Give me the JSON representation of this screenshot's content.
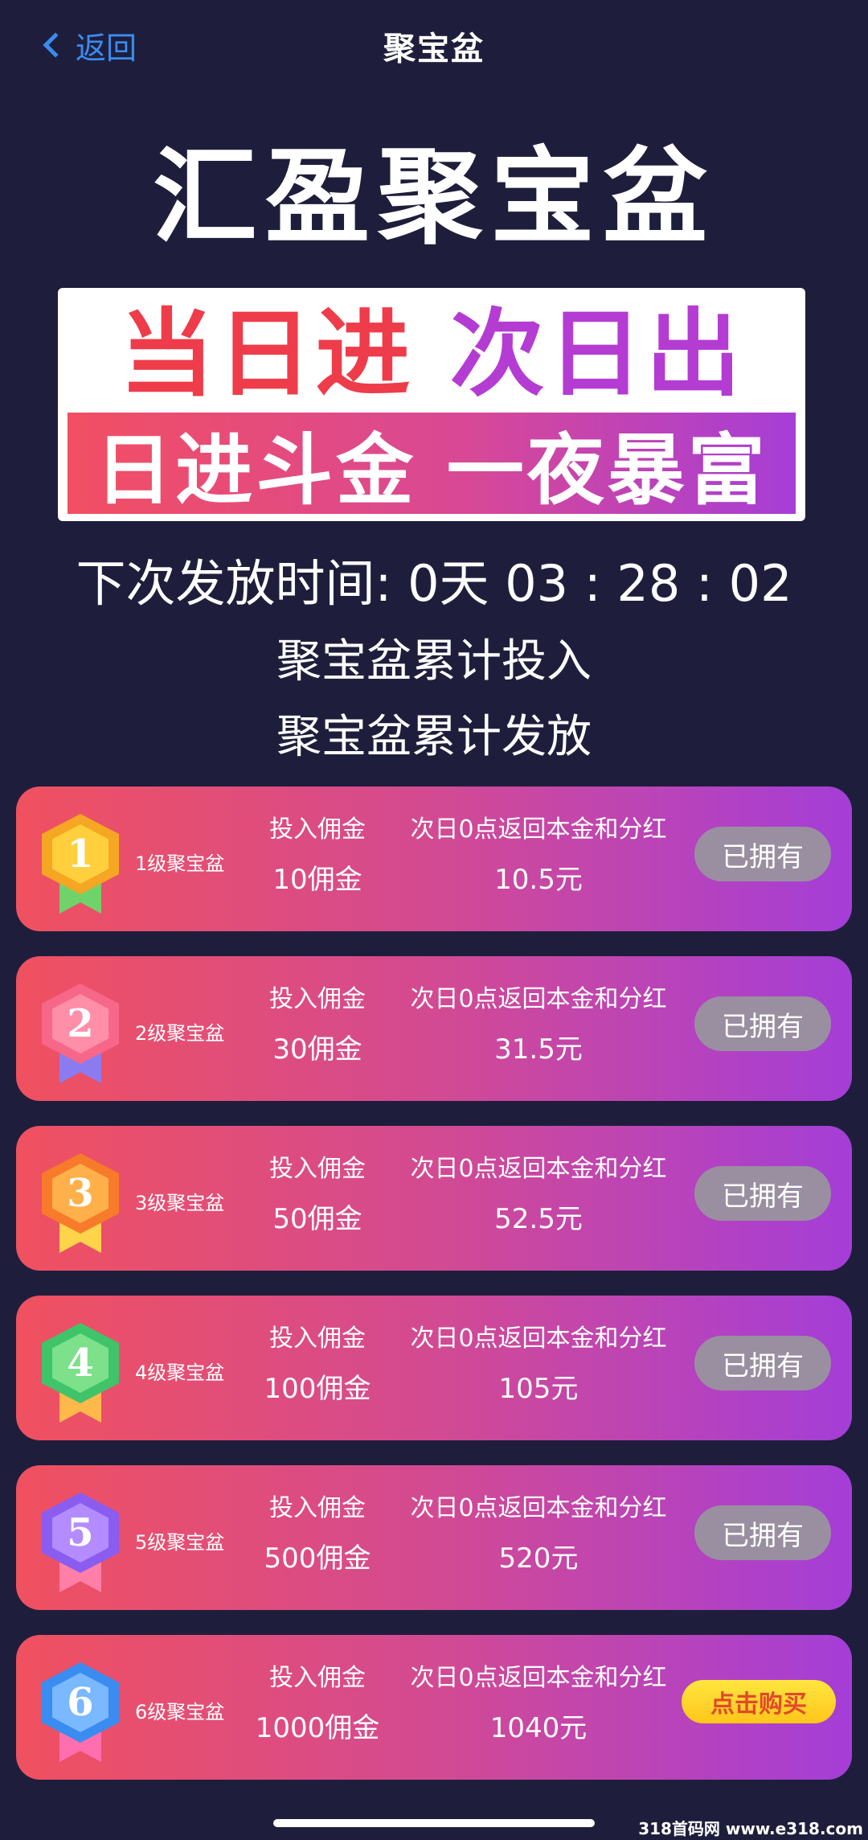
{
  "nav": {
    "back_label": "返回",
    "title": "聚宝盆"
  },
  "hero": {
    "headline": "汇盈聚宝盆",
    "banner_part1": "当日进",
    "banner_part2": "次日出",
    "banner_line2": "日进斗金 一夜暴富"
  },
  "countdown": {
    "label": "下次发放时间:",
    "value": "0天 03 : 28 : 02"
  },
  "stats": {
    "total_invested_label": "聚宝盆累计投入",
    "total_paid_label": "聚宝盆累计发放"
  },
  "levels": [
    {
      "badge_num": "1",
      "name": "1级聚宝盆",
      "invest_head": "投入佣金",
      "invest_value": "10佣金",
      "return_head": "次日0点返回本金和分红",
      "return_value": "10.5元",
      "button": "已拥有",
      "status": "owned",
      "badge_color": "#f5a623",
      "badge_inner": "#ffcf3d",
      "ribbon_color": "#6fd36a"
    },
    {
      "badge_num": "2",
      "name": "2级聚宝盆",
      "invest_head": "投入佣金",
      "invest_value": "30佣金",
      "return_head": "次日0点返回本金和分红",
      "return_value": "31.5元",
      "button": "已拥有",
      "status": "owned",
      "badge_color": "#f7678a",
      "badge_inner": "#ff8fa8",
      "ribbon_color": "#8a7cf0"
    },
    {
      "badge_num": "3",
      "name": "3级聚宝盆",
      "invest_head": "投入佣金",
      "invest_value": "50佣金",
      "return_head": "次日0点返回本金和分红",
      "return_value": "52.5元",
      "button": "已拥有",
      "status": "owned",
      "badge_color": "#f77b2a",
      "badge_inner": "#ffb04a",
      "ribbon_color": "#ffd34a"
    },
    {
      "badge_num": "4",
      "name": "4级聚宝盆",
      "invest_head": "投入佣金",
      "invest_value": "100佣金",
      "return_head": "次日0点返回本金和分红",
      "return_value": "105元",
      "button": "已拥有",
      "status": "owned",
      "badge_color": "#3fc46a",
      "badge_inner": "#7de08a",
      "ribbon_color": "#ffb84a"
    },
    {
      "badge_num": "5",
      "name": "5级聚宝盆",
      "invest_head": "投入佣金",
      "invest_value": "500佣金",
      "return_head": "次日0点返回本金和分红",
      "return_value": "520元",
      "button": "已拥有",
      "status": "owned",
      "badge_color": "#8a5cf0",
      "badge_inner": "#b48cff",
      "ribbon_color": "#ff7fa8"
    },
    {
      "badge_num": "6",
      "name": "6级聚宝盆",
      "invest_head": "投入佣金",
      "invest_value": "1000佣金",
      "return_head": "次日0点返回本金和分红",
      "return_value": "1040元",
      "button": "点击购买",
      "status": "buy",
      "badge_color": "#3a8cf0",
      "badge_inner": "#7ab8ff",
      "ribbon_color": "#ff6fb0"
    }
  ],
  "watermark": "318首码网 www.e318.com"
}
